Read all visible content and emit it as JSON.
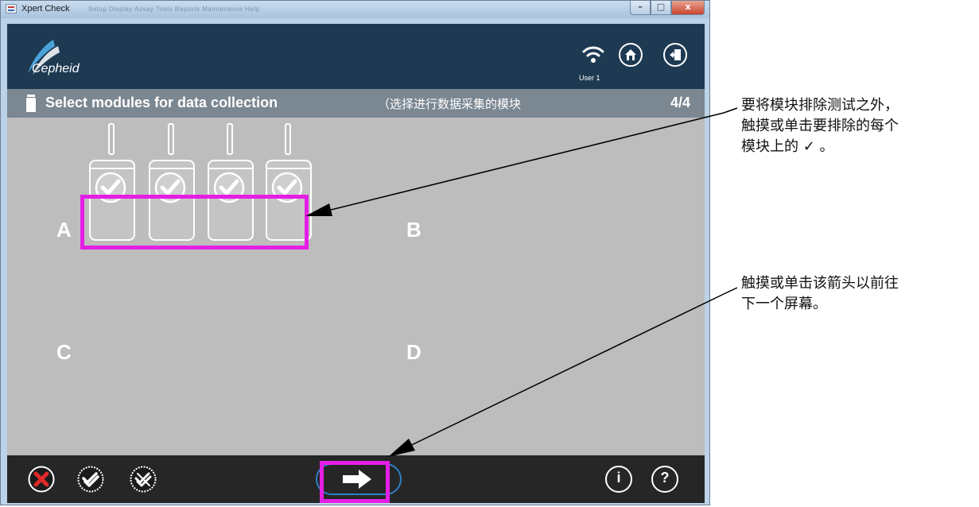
{
  "window": {
    "title": "Xpert Check",
    "minimize_glyph": "–",
    "maximize_glyph": "□",
    "close_glyph": "x",
    "menu_text": "Setup   Display   Assay   Tools   Reports   Maintenance   Help"
  },
  "header": {
    "logo_text": "Cepheid",
    "user": "User 1",
    "icons": [
      "wifi-icon",
      "home-icon",
      "logout-icon"
    ]
  },
  "subheader": {
    "title": "Select modules for data collection",
    "title_cn": "（选择进行数据采集的模块",
    "page": "4/4"
  },
  "groups": [
    {
      "label": "A",
      "modules": [
        {
          "checked": true
        },
        {
          "checked": true
        },
        {
          "checked": true
        },
        {
          "checked": true
        }
      ]
    },
    {
      "label": "B",
      "modules": []
    },
    {
      "label": "C",
      "modules": []
    },
    {
      "label": "D",
      "modules": []
    }
  ],
  "footer": {
    "left_icons": [
      "cancel-icon",
      "select-all-icon",
      "deselect-all-icon"
    ],
    "next_icon": "next-arrow-icon",
    "info_label": "i",
    "help_label": "?"
  },
  "annotations": [
    {
      "lines": [
        "要将模块排除测试之外，",
        "触摸或单击要排除的每个",
        "模块上的 ✓ 。"
      ]
    },
    {
      "lines": [
        "触摸或单击该箭头以前往",
        "下一个屏幕。"
      ]
    }
  ],
  "colors": {
    "header_bg": "#1d3a52",
    "subheader_bg": "#7b8791",
    "content_bg": "#bdbdbd",
    "footer_bg": "#262626",
    "highlight": "#e51ee6",
    "cancel_red": "#e02a2a"
  }
}
